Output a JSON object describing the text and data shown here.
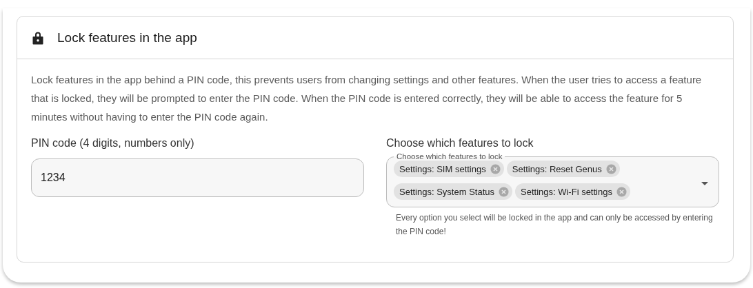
{
  "card": {
    "title": "Lock features in the app",
    "description": "Lock features in the app behind a PIN code, this prevents users from changing settings and other features. When the user tries to access a feature that is locked, they will be prompted to enter the PIN code. When the PIN code is entered correctly, they will be able to access the feature for 5 minutes without having to enter the PIN code again."
  },
  "pin": {
    "label": "PIN code (4 digits, numbers only)",
    "value": "1234"
  },
  "features": {
    "label": "Choose which features to lock",
    "legend": "Choose which features to lock",
    "chips": [
      {
        "label": "Settings: SIM settings"
      },
      {
        "label": "Settings: Reset Genus"
      },
      {
        "label": "Settings: System Status"
      },
      {
        "label": "Settings: Wi-Fi settings"
      }
    ],
    "helper": "Every option you select will be locked in the app and can only be accessed by entering the PIN code!"
  }
}
